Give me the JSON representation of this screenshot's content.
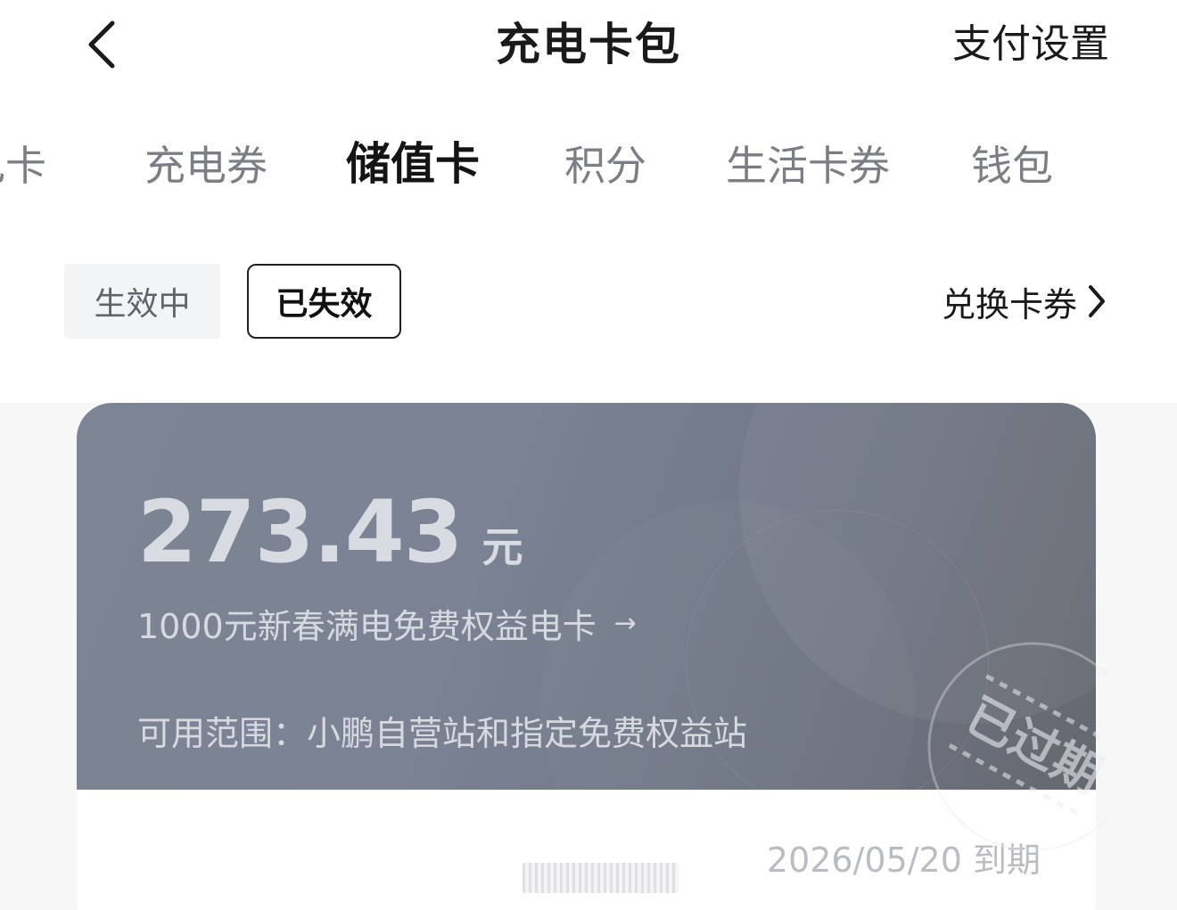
{
  "header": {
    "title": "充电卡包",
    "pay_settings": "支付设置"
  },
  "tabs": [
    {
      "label": "电卡",
      "active": false
    },
    {
      "label": "充电券",
      "active": false
    },
    {
      "label": "储值卡",
      "active": true
    },
    {
      "label": "积分",
      "active": false
    },
    {
      "label": "生活卡券",
      "active": false
    },
    {
      "label": "钱包",
      "active": false
    }
  ],
  "filter": {
    "active_label": "生效中",
    "expired_label": "已失效",
    "redeem_label": "兑换卡券"
  },
  "card": {
    "amount": "273.43",
    "currency": "元",
    "name": "1000元新春满电免费权益电卡",
    "name_arrow": "→",
    "scope": "可用范围：小鹏自营站和指定免费权益站",
    "expire": "2026/05/20 到期",
    "stamp": "已过期"
  },
  "colors": {
    "card_gradient_start": "#7d8595",
    "card_gradient_end": "#64686f",
    "active_text": "#141414",
    "inactive_text": "#7b7f85"
  }
}
